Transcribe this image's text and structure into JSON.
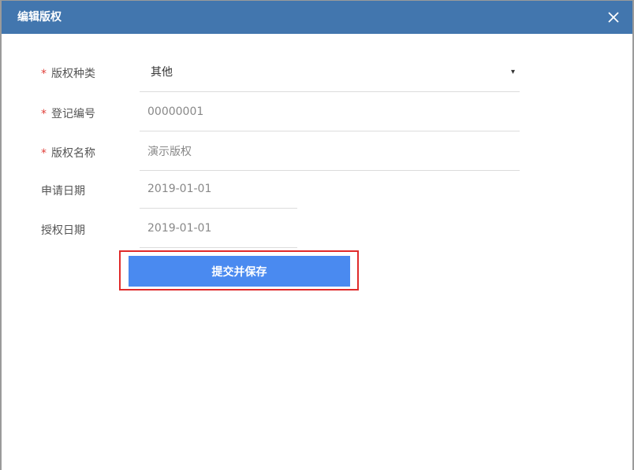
{
  "dialog": {
    "title": "编辑版权",
    "close_icon": "close-icon"
  },
  "form": {
    "type": {
      "label": "版权种类",
      "required": "*",
      "value": "其他",
      "arrow": "▾"
    },
    "reg_no": {
      "label": "登记编号",
      "required": "*",
      "value": "00000001"
    },
    "name": {
      "label": "版权名称",
      "required": "*",
      "value": "演示版权"
    },
    "apply_date": {
      "label": "申请日期",
      "value": "2019-01-01"
    },
    "grant_date": {
      "label": "授权日期",
      "value": "2019-01-01"
    }
  },
  "actions": {
    "submit_label": "提交并保存"
  },
  "colors": {
    "header": "#4276ae",
    "button": "#4a8af0",
    "highlight_border": "#e02b2b",
    "required": "#e0403a"
  }
}
